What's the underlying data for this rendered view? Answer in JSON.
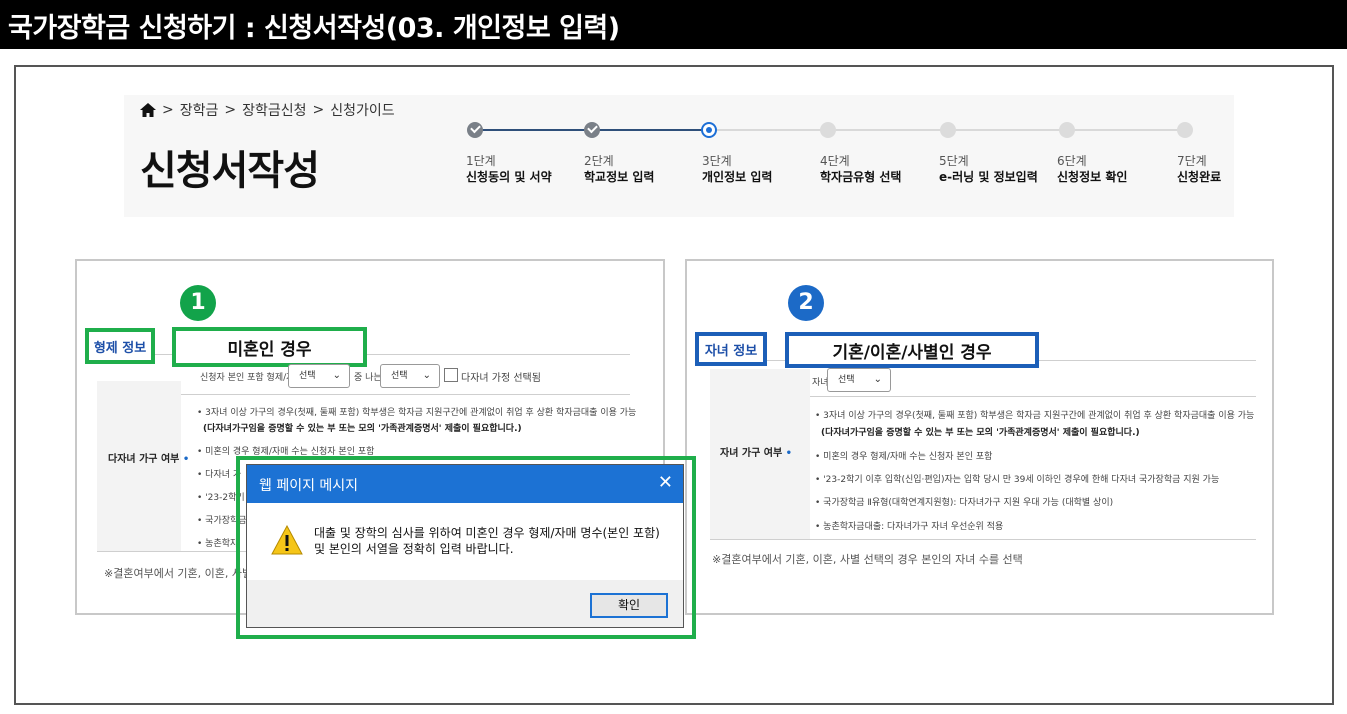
{
  "banner": {
    "title": "국가장학금 신청하기 : 신청서작성(03. 개인정보 입력)"
  },
  "breadcrumb": {
    "items": [
      "장학금",
      "장학금신청",
      "신청가이드"
    ],
    "separator": ">"
  },
  "page": {
    "title": "신청서작성"
  },
  "steps": [
    {
      "num": "1단계",
      "name": "신청동의 및 서약",
      "status": "done"
    },
    {
      "num": "2단계",
      "name": "학교정보 입력",
      "status": "done"
    },
    {
      "num": "3단계",
      "name": "개인정보 입력",
      "status": "current"
    },
    {
      "num": "4단계",
      "name": "학자금유형 선택",
      "status": "todo"
    },
    {
      "num": "5단계",
      "name": "e-러닝 및 정보입력",
      "status": "todo"
    },
    {
      "num": "6단계",
      "name": "신청정보 확인",
      "status": "todo"
    },
    {
      "num": "7단계",
      "name": "신청완료",
      "status": "todo"
    }
  ],
  "left_panel": {
    "marker": "1",
    "tag": "형제 정보",
    "case_label": "미혼인 경우",
    "row_label": "다자녀 가구 여부",
    "row_star": "•",
    "siblings_prefix": "신청자 본인 포함 형제/자매",
    "select1": "선택",
    "middle_text": "중 나는",
    "select2": "선택",
    "checkbox_label": "다자녀 가정 선택됨",
    "bullets": [
      "• 3자녀 이상 가구의 경우(첫째, 둘째 포함) 학부생은 학자금 지원구간에 관계없이 취업 후 상환 학자금대출 이용 가능",
      "(다자녀가구임을 증명할 수 있는 부 또는 모의 '가족관계증명서' 제출이 필요합니다.)",
      "• 미혼의 경우 형제/자매 수는 신청자 본인 포함",
      "• 다자녀 가",
      "• '23-2학기",
      "• 국가장학금",
      "• 농촌학자"
    ],
    "footnote": "※결혼여부에서 기혼, 이혼, 사별 선"
  },
  "right_panel": {
    "marker": "2",
    "tag": "자녀 정보",
    "case_label": "기혼/이혼/사별인 경우",
    "row_label": "자녀 가구 여부",
    "row_star": "•",
    "children_prefix": "자녀",
    "select": "선택",
    "bullets": [
      "• 3자녀 이상 가구의 경우(첫째, 둘째 포함) 학부생은 학자금 지원구간에 관계없이 취업 후 상환 학자금대출 이용 가능",
      "(다자녀가구임을 증명할 수 있는 부 또는 모의 '가족관계증명서' 제출이 필요합니다.)",
      "• 미혼의 경우 형제/자매 수는 신청자 본인 포함",
      "• '23-2학기 이후 입학(신입·편입)자는 입학 당시 만 39세 이하인 경우에 한해 다자녀 국가장학금 지원 가능",
      "• 국가장학금 Ⅱ유형(대학연계지원형): 다자녀가구 지원 우대 가능 (대학별 상이)",
      "• 농촌학자금대출: 다자녀가구 자녀 우선순위 적용"
    ],
    "footnote": "※결혼여부에서 기혼, 이혼, 사별 선택의 경우 본인의 자녀 수를 선택"
  },
  "dialog": {
    "title": "웹 페이지 메시지",
    "close": "✕",
    "message": "대출 및 장학의 심사를 위하여 미혼인 경우 형제/자매 명수(본인 포함) 및 본인의 서열을 정확히 입력 바랍니다.",
    "ok": "확인"
  },
  "colors": {
    "highlight_green": "#1fae4b",
    "highlight_blue": "#1c5fb8",
    "step_current": "#1d6fd6",
    "dialog_titlebar": "#1c72d4"
  }
}
